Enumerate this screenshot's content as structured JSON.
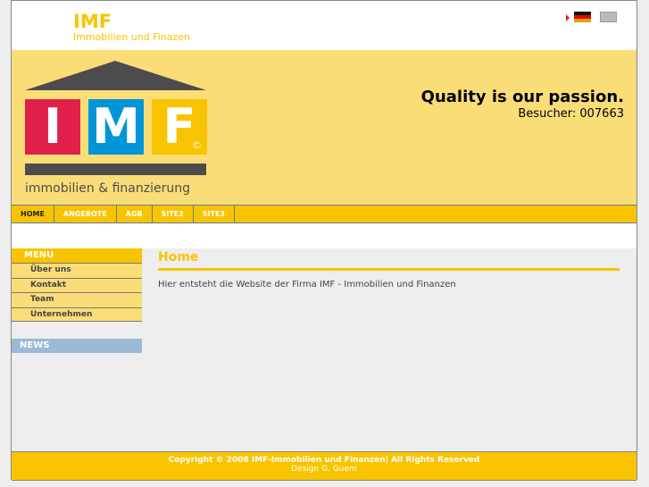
{
  "header": {
    "brand": "IMF",
    "subtitle": "Immobilien und Finazen",
    "flags": [
      "german-flag-icon",
      "english-flag-icon"
    ]
  },
  "banner": {
    "logo_letters": [
      "I",
      "M",
      "F"
    ],
    "logo_text": "immobilien & finanzierung",
    "logo_mark": "©",
    "slogan": "Quality is our passion.",
    "visitors": "Besucher: 007663"
  },
  "nav": [
    "HOME",
    "ANGEBOTE",
    "AGB",
    "SITE2",
    "SITE3"
  ],
  "sidebar": {
    "menu_title": "MENU",
    "items": [
      "Über uns",
      "Kontakt",
      "Team",
      "Unternehmen"
    ],
    "news_title": "NEWS"
  },
  "main": {
    "title": "Home",
    "text": "Hier entsteht die Website der Firma IMF - Immobilien und Finanzen"
  },
  "footer": {
    "copyright": "Copyright © 2008 IMF-Immobilien und Finanzen|  All Rights Reserved",
    "design_label": "Design",
    "designer": "G. Guem"
  },
  "colors": {
    "yellow": "#f8c400",
    "light_yellow": "#fbdd78",
    "red": "#e0204a",
    "blue": "#0095d9"
  }
}
